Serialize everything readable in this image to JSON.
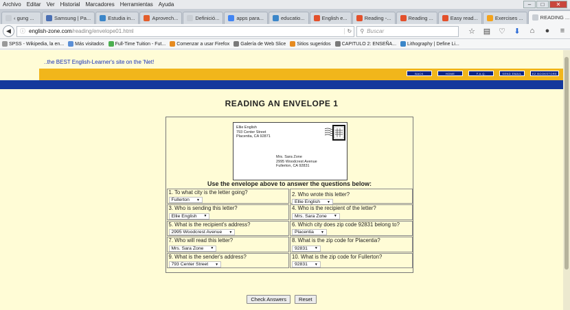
{
  "browser": {
    "menu": [
      "Archivo",
      "Editar",
      "Ver",
      "Historial",
      "Marcadores",
      "Herramientas",
      "Ayuda"
    ],
    "tabs": [
      {
        "label": "‹ gung ...",
        "color": "#c9ced4"
      },
      {
        "label": "Samsung | Pa...",
        "color": "#4a6fb3"
      },
      {
        "label": "Estudia in...",
        "color": "#3b86c9"
      },
      {
        "label": "Aprovech...",
        "color": "#e35d2b"
      },
      {
        "label": "Definició...",
        "color": "#c9ced4"
      },
      {
        "label": "apps para...",
        "color": "#4285f4"
      },
      {
        "label": "educatio...",
        "color": "#3b86c9"
      },
      {
        "label": "English e...",
        "color": "#e3502b"
      },
      {
        "label": "Reading -...",
        "color": "#e3502b"
      },
      {
        "label": "Reading ...",
        "color": "#e3502b"
      },
      {
        "label": "Easy read...",
        "color": "#e3502b"
      },
      {
        "label": "Exercises ...",
        "color": "#f4a31b"
      },
      {
        "label": "READING ...",
        "color": "#c9ced4",
        "active": true
      }
    ],
    "address": {
      "host": "english-zone.com",
      "path": "/reading/envelope01.html"
    },
    "search_placeholder": "Buscar",
    "bookmarks": [
      {
        "label": "SPSS - Wikipedia, la en...",
        "color": "#999999"
      },
      {
        "label": "Más visitados",
        "color": "#5b8fd6"
      },
      {
        "label": "Full-Time Tuition - Fut...",
        "color": "#4caf50"
      },
      {
        "label": "Comenzar a usar Firefox",
        "color": "#e68a1f"
      },
      {
        "label": "Galería de Web Slice",
        "color": "#7a7a7a"
      },
      {
        "label": "Sitios sugeridos",
        "color": "#e68a1f"
      },
      {
        "label": "CAPITULO 2: ENSEÑA...",
        "color": "#7a7a7a"
      },
      {
        "label": "Lithography | Define Li...",
        "color": "#3b86c9"
      }
    ]
  },
  "site": {
    "tagline": "..the BEST English-Learner's site on the 'Net!",
    "nav": [
      "BACK",
      "HOME",
      "F.A.Q.",
      "SEND EMAIL",
      "EZ BOOKSTORE"
    ],
    "title": "READING AN ENVELOPE 1"
  },
  "envelope": {
    "sender": [
      "Ellie English",
      "793 Center Street",
      "Placentia, CA 92871"
    ],
    "recipient": [
      "Mrs. Sara Zone",
      "2995 Woodcrest Avenue",
      "Fullerton, CA 92831"
    ]
  },
  "instruction": "Use the envelope above to answer the questions below:",
  "questions": [
    {
      "q": "1. To what city is the letter going?",
      "a": "Fullerton",
      "top": false
    },
    {
      "q": "2. Who wrote this letter?",
      "a": "Ellie English",
      "top": true
    },
    {
      "q": "3. Who is sending this letter?",
      "a": "Ellie English",
      "top": false
    },
    {
      "q": "4. Who is the recipient of the letter?",
      "a": "Mrs. Sara Zone",
      "top": false
    },
    {
      "q": "5. What is the recipient's address?",
      "a": "2995 Woodcrest Avenue",
      "top": false
    },
    {
      "q": "6. Which city does zip code 92831 belong to?",
      "a": "Placentia",
      "top": false
    },
    {
      "q": "7. Who will read this letter?",
      "a": "Mrs. Sara Zone",
      "top": false
    },
    {
      "q": "8. What is the zip code for Placentia?",
      "a": "92831",
      "top": false
    },
    {
      "q": "9. What is the sender's address?",
      "a": "793 Center Street",
      "top": false
    },
    {
      "q": "10. What is the zip code for Fullerton?",
      "a": "92831",
      "top": false
    }
  ],
  "buttons": {
    "check": "Check Answers",
    "reset": "Reset"
  }
}
